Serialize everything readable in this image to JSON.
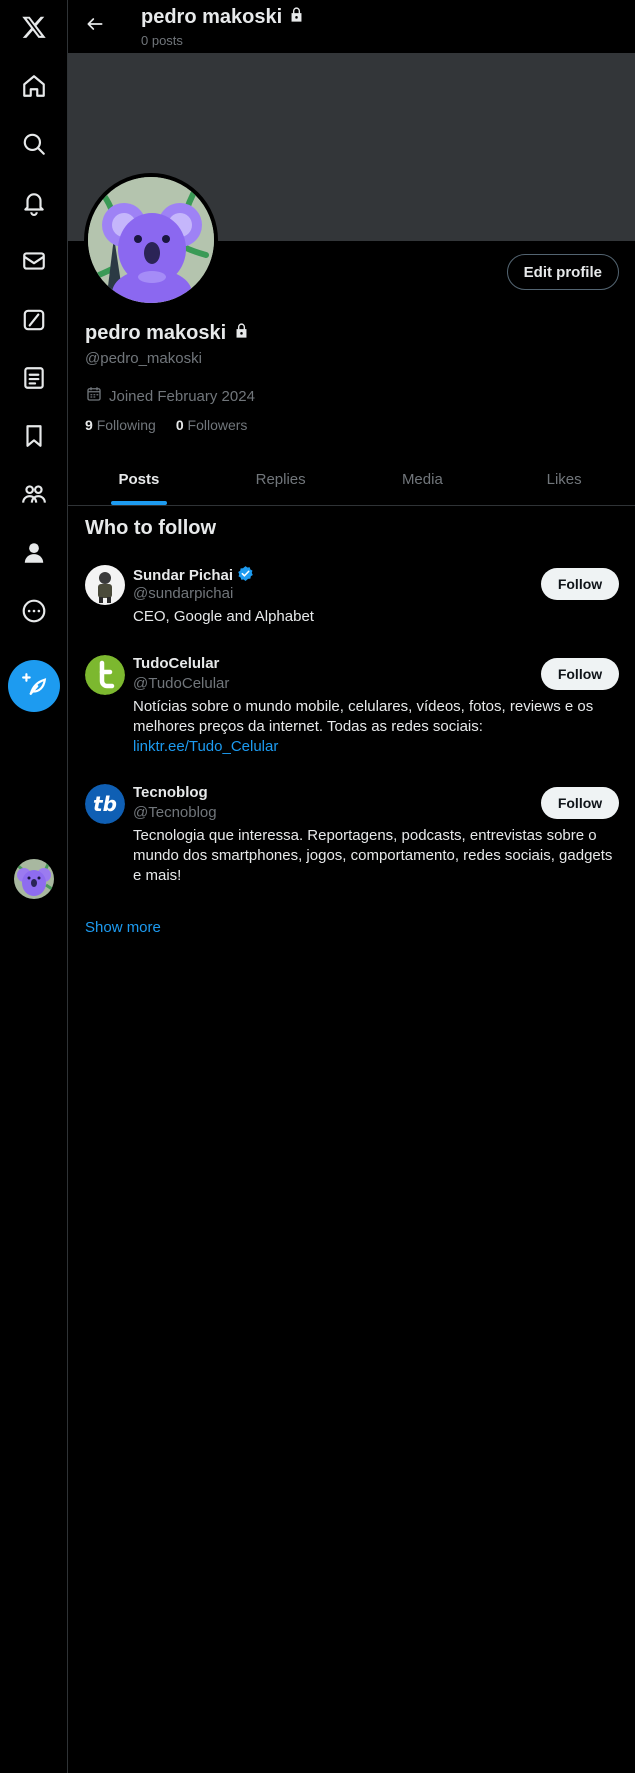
{
  "header": {
    "name": "pedro makoski",
    "posts_count": "0 posts"
  },
  "profile": {
    "name": "pedro makoski",
    "handle": "@pedro_makoski",
    "joined": "Joined February 2024",
    "following_count": "9",
    "following_label": "Following",
    "followers_count": "0",
    "followers_label": "Followers",
    "edit_button": "Edit profile"
  },
  "tabs": [
    {
      "label": "Posts",
      "active": true
    },
    {
      "label": "Replies",
      "active": false
    },
    {
      "label": "Media",
      "active": false
    },
    {
      "label": "Likes",
      "active": false
    }
  ],
  "who_to_follow": {
    "title": "Who to follow",
    "show_more": "Show more",
    "follow_label": "Follow",
    "suggestions": [
      {
        "name": "Sundar Pichai",
        "handle": "@sundarpichai",
        "verified": true,
        "bio": "CEO, Google and Alphabet",
        "bio_link": ""
      },
      {
        "name": "TudoCelular",
        "handle": "@TudoCelular",
        "verified": false,
        "bio": "Notícias sobre o mundo mobile, celulares, vídeos, fotos, reviews e os melhores preços da internet. Todas as redes sociais:",
        "bio_link": "linktr.ee/Tudo_Celular"
      },
      {
        "name": "Tecnoblog",
        "handle": "@Tecnoblog",
        "verified": false,
        "bio": "Tecnologia que interessa. Reportagens, podcasts, entrevistas sobre o mundo dos smartphones, jogos, comportamento, redes sociais, gadgets e mais!",
        "bio_link": ""
      }
    ]
  },
  "sidebar": {
    "icons": [
      "x-logo-icon",
      "home-icon",
      "search-icon",
      "notifications-icon",
      "messages-icon",
      "grok-icon",
      "lists-icon",
      "bookmarks-icon",
      "communities-icon",
      "profile-icon",
      "more-icon"
    ],
    "compose_icon": "compose-post-icon"
  },
  "colors": {
    "accent": "#1d9bf0",
    "background": "#000000",
    "text": "#e7e9ea",
    "muted": "#71767b",
    "border": "#2f3336",
    "banner": "#333639"
  }
}
